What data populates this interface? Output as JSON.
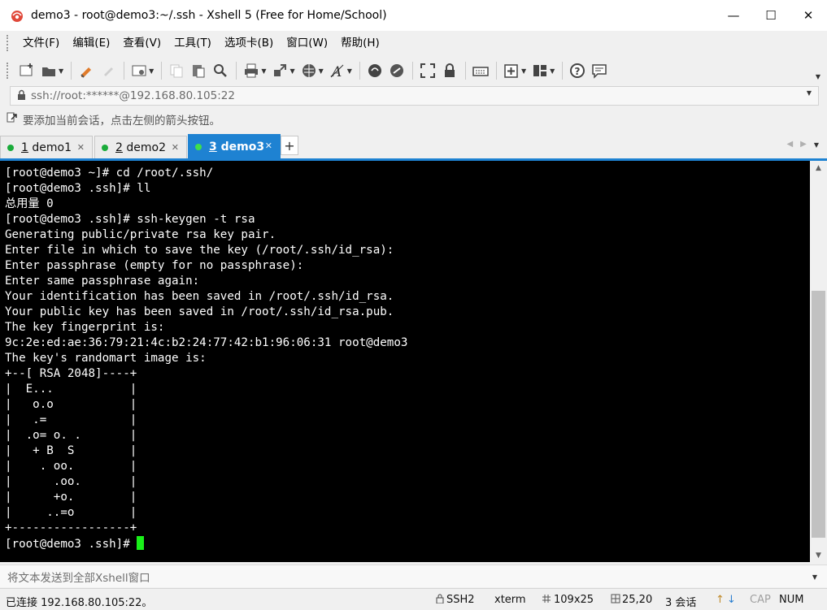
{
  "window": {
    "title": "demo3 - root@demo3:~/.ssh - Xshell 5 (Free for Home/School)",
    "minimize": "—",
    "maximize": "☐",
    "close": "✕"
  },
  "menu": {
    "items": [
      "文件(F)",
      "编辑(E)",
      "查看(V)",
      "工具(T)",
      "选项卡(B)",
      "窗口(W)",
      "帮助(H)"
    ]
  },
  "toolbar": {
    "icons": [
      "new-session-icon",
      "open-folder-icon",
      "reconnect-icon",
      "disconnect-icon",
      "properties-icon",
      "copy-icon",
      "paste-icon",
      "find-icon",
      "print-icon",
      "transfer-icon",
      "globe-icon",
      "font-icon",
      "xftp-icon",
      "tunnel-icon",
      "fullscreen-icon",
      "lock-icon",
      "keyboard-icon",
      "add-tab-icon",
      "layout-icon",
      "help-icon",
      "chat-icon"
    ]
  },
  "address": {
    "value": "ssh://root:******@192.168.80.105:22"
  },
  "hint": {
    "text": "要添加当前会话，点击左侧的箭头按钮。"
  },
  "tabs": [
    {
      "num": "1",
      "label": " demo1",
      "active": false
    },
    {
      "num": "2",
      "label": " demo2",
      "active": false
    },
    {
      "num": "3",
      "label": " demo3",
      "active": true
    }
  ],
  "tab_add": "+",
  "terminal": {
    "lines": [
      "[root@demo3 ~]# cd /root/.ssh/",
      "[root@demo3 .ssh]# ll",
      "总用量 0",
      "[root@demo3 .ssh]# ssh-keygen -t rsa",
      "Generating public/private rsa key pair.",
      "Enter file in which to save the key (/root/.ssh/id_rsa):",
      "Enter passphrase (empty for no passphrase):",
      "Enter same passphrase again:",
      "Your identification has been saved in /root/.ssh/id_rsa.",
      "Your public key has been saved in /root/.ssh/id_rsa.pub.",
      "The key fingerprint is:",
      "9c:2e:ed:ae:36:79:21:4c:b2:24:77:42:b1:96:06:31 root@demo3",
      "The key's randomart image is:",
      "+--[ RSA 2048]----+",
      "|  E...           |",
      "|   o.o           |",
      "|   .=            |",
      "|  .o= o. .       |",
      "|   + B  S        |",
      "|    . oo.        |",
      "|      .oo.       |",
      "|      +o.        |",
      "|     ..=o        |",
      "+-----------------+"
    ],
    "prompt": "[root@demo3 .ssh]# ",
    "cursor_color": "#19f019"
  },
  "sendbar": {
    "placeholder": "将文本发送到全部Xshell窗口"
  },
  "status": {
    "connection": "已连接 192.168.80.105:22。",
    "protocol": "SSH2",
    "terminal_type": "xterm",
    "size": "109x25",
    "cursor_pos": "25,20",
    "sessions": "3 会话",
    "caps": "CAP",
    "num": "NUM"
  },
  "colors": {
    "accent": "#1e82d2",
    "tab_dot": "#1aab3a",
    "terminal_bg": "#000000",
    "terminal_fg": "#ffffff"
  }
}
